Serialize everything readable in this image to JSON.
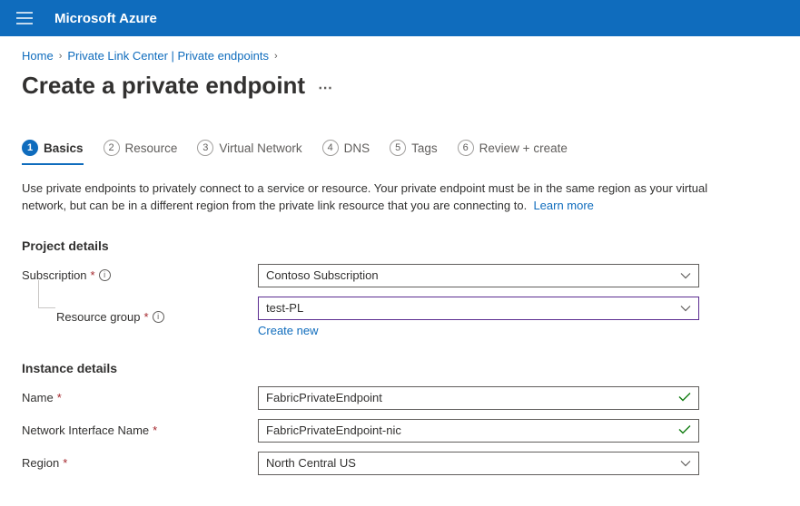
{
  "header": {
    "brand": "Microsoft Azure"
  },
  "breadcrumb": {
    "home": "Home",
    "section": "Private Link Center | Private endpoints"
  },
  "page": {
    "title": "Create a private endpoint"
  },
  "tabs": [
    {
      "num": "1",
      "label": "Basics"
    },
    {
      "num": "2",
      "label": "Resource"
    },
    {
      "num": "3",
      "label": "Virtual Network"
    },
    {
      "num": "4",
      "label": "DNS"
    },
    {
      "num": "5",
      "label": "Tags"
    },
    {
      "num": "6",
      "label": "Review + create"
    }
  ],
  "intro": {
    "text": "Use private endpoints to privately connect to a service or resource. Your private endpoint must be in the same region as your virtual network, but can be in a different region from the private link resource that you are connecting to.",
    "learn_more": "Learn more"
  },
  "sections": {
    "project": {
      "title": "Project details",
      "subscription_label": "Subscription",
      "subscription_value": "Contoso Subscription",
      "resource_group_label": "Resource group",
      "resource_group_value": "test-PL",
      "create_new": "Create new"
    },
    "instance": {
      "title": "Instance details",
      "name_label": "Name",
      "name_value": "FabricPrivateEndpoint",
      "nic_label": "Network Interface Name",
      "nic_value": "FabricPrivateEndpoint-nic",
      "region_label": "Region",
      "region_value": "North Central US"
    }
  }
}
